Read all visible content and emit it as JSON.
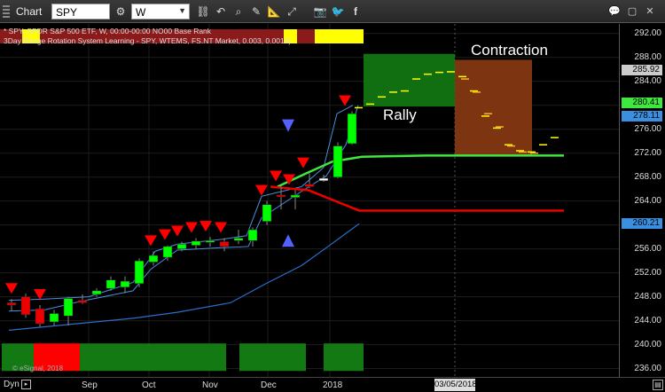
{
  "toolbar": {
    "title": "Chart",
    "symbol": "SPY",
    "interval": "W",
    "icons": [
      "settings-icon",
      "link-icon",
      "undo-icon",
      "search-icon",
      "draw-icon",
      "ruler-icon",
      "expand-icon",
      "camera-icon",
      "twitter-icon",
      "facebook-icon"
    ],
    "right_icons": [
      "chat-icon",
      "maximize-icon",
      "close-icon"
    ]
  },
  "study": {
    "line1": "* SPY, SPDR S&P 500 ETF, W, 00:00-00:00 NO00 Base Rank",
    "line2": "3Day Range Rotation System Learning - SPY, WTEMS, FS.NT Market, 0.003, 0.0018)"
  },
  "annotations": {
    "rally": "Rally",
    "contraction": "Contraction"
  },
  "watermark": "© eSignal, 2018",
  "footer": {
    "dyn": "Dyn",
    "date": "03/05/2018"
  },
  "yaxis": {
    "ticks": [
      "292.00",
      "288.00",
      "284.00",
      "280.00",
      "276.00",
      "272.00",
      "268.00",
      "264.00",
      "260.00",
      "256.00",
      "252.00",
      "248.00",
      "244.00",
      "240.00",
      "236.00"
    ],
    "badges": [
      {
        "label": "285.92",
        "color": "#cccccc"
      },
      {
        "label": "280.41",
        "color": "#3fe83f"
      },
      {
        "label": "278.11",
        "color": "#3a8fe0"
      },
      {
        "label": "260.21",
        "color": "#3a8fe0"
      }
    ]
  },
  "xaxis": {
    "labels": [
      "Sep",
      "Oct",
      "Nov",
      "Dec",
      "2018"
    ]
  },
  "chart_data": {
    "type": "candlestick",
    "ylim": [
      234.6,
      293.6
    ],
    "candles": [
      {
        "o": 246.6,
        "h": 247.6,
        "l": 245.6,
        "c": 247.0,
        "color": "red"
      },
      {
        "o": 248.0,
        "h": 248.5,
        "l": 244.5,
        "c": 245.0,
        "color": "red"
      },
      {
        "o": 246.0,
        "h": 246.6,
        "l": 243.0,
        "c": 243.5,
        "color": "red"
      },
      {
        "o": 243.8,
        "h": 245.8,
        "l": 243.2,
        "c": 245.2,
        "color": "green"
      },
      {
        "o": 244.8,
        "h": 248.0,
        "l": 243.2,
        "c": 247.7,
        "color": "green"
      },
      {
        "o": 247.4,
        "h": 248.4,
        "l": 246.8,
        "c": 247.0,
        "color": "red"
      },
      {
        "o": 248.4,
        "h": 249.4,
        "l": 248.0,
        "c": 249.0,
        "color": "green"
      },
      {
        "o": 249.4,
        "h": 251.4,
        "l": 249.0,
        "c": 250.8,
        "color": "green"
      },
      {
        "o": 249.6,
        "h": 251.4,
        "l": 248.6,
        "c": 250.6,
        "color": "green"
      },
      {
        "o": 250.2,
        "h": 254.4,
        "l": 249.6,
        "c": 254.0,
        "color": "green"
      },
      {
        "o": 253.8,
        "h": 255.6,
        "l": 253.2,
        "c": 254.9,
        "color": "green"
      },
      {
        "o": 254.6,
        "h": 256.6,
        "l": 254.0,
        "c": 256.4,
        "color": "green"
      },
      {
        "o": 256.0,
        "h": 257.2,
        "l": 255.6,
        "c": 256.8,
        "color": "green"
      },
      {
        "o": 256.6,
        "h": 257.8,
        "l": 256.0,
        "c": 257.3,
        "color": "green"
      },
      {
        "o": 257.2,
        "h": 258.0,
        "l": 256.4,
        "c": 257.4,
        "color": "green"
      },
      {
        "o": 257.2,
        "h": 257.8,
        "l": 255.6,
        "c": 256.4,
        "color": "red"
      },
      {
        "o": 257.4,
        "h": 259.2,
        "l": 256.8,
        "c": 257.8,
        "color": "green"
      },
      {
        "o": 257.4,
        "h": 259.6,
        "l": 256.4,
        "c": 259.2,
        "color": "green"
      },
      {
        "o": 260.6,
        "h": 264.0,
        "l": 260.0,
        "c": 263.4,
        "color": "green"
      },
      {
        "o": 264.8,
        "h": 266.4,
        "l": 262.6,
        "c": 265.0,
        "color": "red"
      },
      {
        "o": 264.6,
        "h": 265.8,
        "l": 262.6,
        "c": 265.0,
        "color": "green"
      },
      {
        "o": 266.8,
        "h": 268.6,
        "l": 266.2,
        "c": 266.4,
        "color": "red"
      },
      {
        "o": 267.4,
        "h": 268.4,
        "l": 267.2,
        "c": 267.8,
        "color": "white"
      },
      {
        "o": 268.0,
        "h": 273.8,
        "l": 267.8,
        "c": 273.2,
        "color": "green"
      },
      {
        "o": 273.6,
        "h": 279.0,
        "l": 273.4,
        "c": 278.6,
        "color": "green"
      }
    ],
    "projection_yellow": [
      279.6,
      280.2,
      281.4,
      282.2,
      282.4,
      284.4,
      285.2,
      285.5,
      285.6,
      284.8,
      282.4,
      278.2,
      276.2,
      273.4,
      272.4,
      272.2,
      273.4,
      274.6
    ],
    "projection_orange": [
      284.4,
      282.2,
      278.6,
      276.4,
      273.2,
      272.2,
      272.0
    ],
    "green_line": [
      [
        313,
        266.4
      ],
      [
        345,
        268.6
      ],
      [
        375,
        270.6
      ],
      [
        408,
        271.4
      ],
      [
        480,
        271.6
      ],
      [
        636,
        271.6
      ]
    ],
    "red_line": [
      [
        305,
        266.4
      ],
      [
        348,
        265.8
      ],
      [
        405,
        262.4
      ],
      [
        636,
        262.4
      ]
    ],
    "blue_line": [
      [
        10,
        242.4
      ],
      [
        80,
        243.4
      ],
      [
        150,
        244.4
      ],
      [
        200,
        245.4
      ],
      [
        260,
        247.0
      ],
      [
        300,
        250.2
      ],
      [
        340,
        253.2
      ],
      [
        370,
        256.4
      ],
      [
        405,
        260.2
      ]
    ],
    "band_upper": [
      [
        10,
        247.4
      ],
      [
        50,
        247.6
      ],
      [
        100,
        248.0
      ],
      [
        150,
        250.4
      ],
      [
        175,
        255.6
      ],
      [
        200,
        256.8
      ],
      [
        250,
        257.6
      ],
      [
        278,
        258.2
      ],
      [
        295,
        264.8
      ],
      [
        340,
        266.4
      ],
      [
        365,
        269.6
      ],
      [
        380,
        278.6
      ],
      [
        398,
        280.0
      ]
    ],
    "band_lower": [
      [
        10,
        245.6
      ],
      [
        50,
        245.8
      ],
      [
        90,
        247.2
      ],
      [
        150,
        249.0
      ],
      [
        170,
        252.6
      ],
      [
        200,
        255.8
      ],
      [
        250,
        256.2
      ],
      [
        280,
        256.4
      ],
      [
        295,
        261.2
      ],
      [
        340,
        265.6
      ],
      [
        368,
        268.2
      ],
      [
        390,
        273.4
      ],
      [
        404,
        280.0
      ]
    ],
    "sell_arrows_x": [
      13,
      45,
      170,
      186,
      200,
      216,
      232,
      249,
      295,
      311,
      326,
      342,
      389
    ],
    "buy_arrows": [
      {
        "x": 325,
        "y": 276.6,
        "dir": "down"
      },
      {
        "x": 325,
        "y": 257.4,
        "dir": "up"
      }
    ],
    "boxes": [
      {
        "name": "rally-zone",
        "x0": 410,
        "x1": 513,
        "y0": 279.8,
        "y1": 288.6,
        "color": "#137a13"
      },
      {
        "name": "contraction-zone",
        "x0": 513,
        "x1": 600,
        "y0": 271.6,
        "y1": 287.6,
        "color": "#8a3b12"
      }
    ],
    "grid": true
  }
}
